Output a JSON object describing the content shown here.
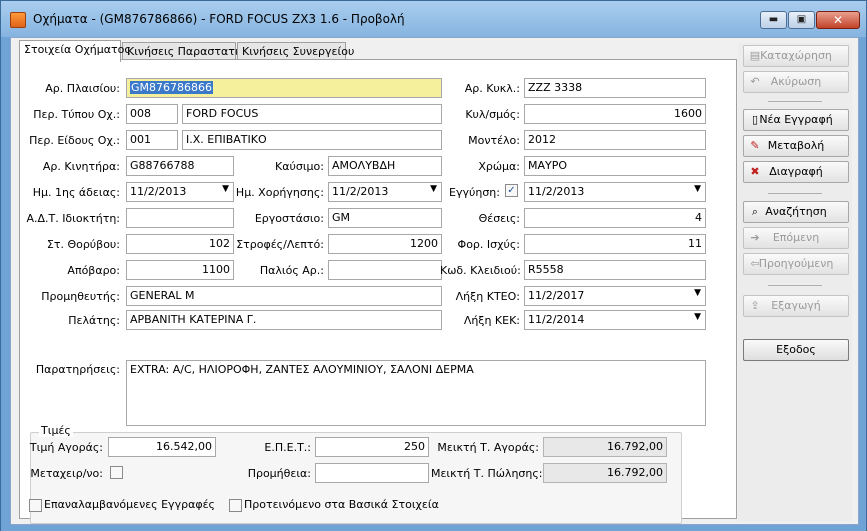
{
  "window": {
    "title": "Οχήματα - (GM876786866)  - FORD FOCUS ZX3 1.6 - Προβολή",
    "close_glyph": "✕",
    "min_glyph": "▬",
    "max_glyph": "▣"
  },
  "tabs": [
    "Στοιχεία Οχήματος",
    "Κινήσεις Παραστατικά",
    "Κινήσεις Συνεργείου"
  ],
  "fields": {
    "ar_plaisiou": {
      "label": "Αρ. Πλαισίου:",
      "value": "GM876786866"
    },
    "per_typou": {
      "label": "Περ. Τύπου Οχ.:",
      "code": "008",
      "value": "FORD FOCUS"
    },
    "per_eidous": {
      "label": "Περ. Είδους Οχ.:",
      "code": "001",
      "value": "Ι.Χ. ΕΠΙΒΑΤΙΚΟ"
    },
    "ar_kinitira": {
      "label": "Αρ. Κινητήρα:",
      "value": "G88766788"
    },
    "kafsimo": {
      "label": "Καύσιμο:",
      "value": "ΑΜΟΛΥΒΔΗ"
    },
    "im_1is_adeias": {
      "label": "Ημ. 1ης άδειας:",
      "value": "11/2/2013"
    },
    "im_xorigisis": {
      "label": "Ημ. Χορήγησης:",
      "value": "11/2/2013"
    },
    "adt": {
      "label": "Α.Δ.Τ. Ιδιοκτήτη:",
      "value": ""
    },
    "ergostasio": {
      "label": "Εργοστάσιο:",
      "value": "GM"
    },
    "st_thoryvou": {
      "label": "Στ. Θορύβου:",
      "value": "102"
    },
    "strofes": {
      "label": "Στροφές/Λεπτό:",
      "value": "1200"
    },
    "apovaro": {
      "label": "Απόβαρο:",
      "value": "1100"
    },
    "palios_ar": {
      "label": "Παλιός Αρ.:",
      "value": ""
    },
    "promitheftis": {
      "label": "Προμηθευτής:",
      "value": "GENERAL M"
    },
    "pelatis": {
      "label": "Πελάτης:",
      "value": "ΑΡΒΑΝΙΤΗ ΚΑΤΕΡΙΝΑ Γ."
    },
    "ar_kykl": {
      "label": "Αρ. Κυκλ.:",
      "value": "ZZZ 3338"
    },
    "kyl_smos": {
      "label": "Κυλ/σμός:",
      "value": "1600"
    },
    "montelo": {
      "label": "Μοντέλο:",
      "value": "2012"
    },
    "xroma": {
      "label": "Χρώμα:",
      "value": "ΜΑΥΡΟ"
    },
    "engyisi": {
      "label": "Εγγύηση:",
      "value": "11/2/2013",
      "checked": true
    },
    "theseis": {
      "label": "Θέσεις:",
      "value": "4"
    },
    "for_isxys": {
      "label": "Φορ. Ισχύς:",
      "value": "11"
    },
    "kod_kleidiou": {
      "label": "Κωδ. Κλειδιού:",
      "value": "R5558"
    },
    "lixi_kteo": {
      "label": "Λήξη ΚΤΕΟ:",
      "value": "11/2/2017"
    },
    "lixi_kek": {
      "label": "Λήξη ΚΕΚ:",
      "value": "11/2/2014"
    },
    "paratiriseis": {
      "label": "Παρατηρήσεις:",
      "value": "EXTRA: A/C, ΗΛΙΟΡΟΦΗ, ΖΑΝΤΕΣ ΑΛΟΥΜΙΝΙΟΥ, ΣΑΛΟΝΙ ΔΕΡΜΑ"
    }
  },
  "prices": {
    "legend": "Τιμές",
    "timi_agoras": {
      "label": "Τιμή Αγοράς:",
      "value": "16.542,00"
    },
    "metaxeir": {
      "label": "Μεταχειρ/νο:",
      "checked": false
    },
    "epet": {
      "label": "Ε.Π.Ε.Τ.:",
      "value": "250"
    },
    "promitheia": {
      "label": "Προμήθεια:",
      "value": ""
    },
    "mikti_agoras": {
      "label": "Μεικτή Τ. Αγοράς:",
      "value": "16.792,00"
    },
    "mikti_polisis": {
      "label": "Μεικτή Τ. Πώλησης:",
      "value": "16.792,00"
    }
  },
  "footer": {
    "repeat_records": "Επαναλαμβανόμενες Εγγραφές",
    "proposed": "Προτεινόμενο στα Βασικά Στοιχεία"
  },
  "sidebar": {
    "save": "Καταχώρηση",
    "cancel": "Ακύρωση",
    "new": "Νέα Εγγραφή",
    "edit": "Μεταβολή",
    "delete": "Διαγραφή",
    "search": "Αναζήτηση",
    "next": "Επόμενη",
    "prev": "Προηγούμενη",
    "export": "Εξαγωγή",
    "exit": "Εξοδος"
  }
}
